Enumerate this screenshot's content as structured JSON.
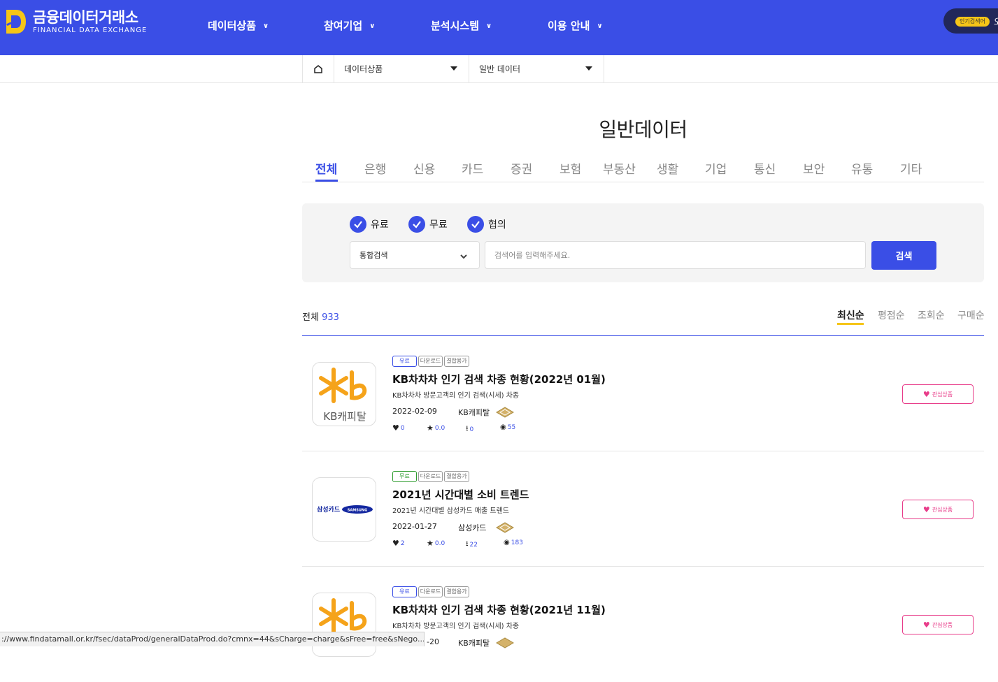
{
  "header": {
    "logo_ko": "금융데이터거래소",
    "logo_en": "FINANCIAL DATA EXCHANGE",
    "nav": [
      "데이터상품",
      "참여기업",
      "분석시스템",
      "이용 안내"
    ],
    "popular_badge": "인기검색어",
    "popular_rest": "오"
  },
  "breadcrumb": {
    "level1": "데이터상품",
    "level2": "일반 데이터"
  },
  "page_title": "일반데이터",
  "categories": [
    "전체",
    "은행",
    "신용",
    "카드",
    "증권",
    "보험",
    "부동산",
    "생활",
    "기업",
    "통신",
    "보안",
    "유통",
    "기타"
  ],
  "active_category": "전체",
  "filters": {
    "checks": [
      "유료",
      "무료",
      "협의"
    ],
    "search_type": "통합검색",
    "placeholder": "검색어를 입력해주세요.",
    "search_button": "검색"
  },
  "summary": {
    "total_label": "전체",
    "total_count": "933",
    "sorts": [
      "최신순",
      "평점순",
      "조회순",
      "구매순"
    ]
  },
  "items": [
    {
      "tags": [
        "유료",
        "다운로드",
        "결합용가"
      ],
      "title": "KB차차차 인기 검색 차종 현황(2022년 01월)",
      "desc": "KB차차차 방문고객의 인기 검색(시세) 차종",
      "date": "2022-02-09",
      "company": "KB캐피탈",
      "likes": "0",
      "rating": "0.0",
      "downloads": "0",
      "views": "55",
      "logo_text": "KB캐피탈",
      "fav": "관심상품"
    },
    {
      "tags": [
        "무료",
        "다운로드",
        "결합용가"
      ],
      "title": "2021년 시간대별 소비 트렌드",
      "desc": "2021년 시간대별 삼성카드 매출 트렌드",
      "date": "2022-01-27",
      "company": "삼성카드",
      "likes": "2",
      "rating": "0.0",
      "downloads": "22",
      "views": "183",
      "logo_text": "삼성카드",
      "logo_text2": "SAMSUNG",
      "fav": "관심상품"
    },
    {
      "tags": [
        "유료",
        "다운로드",
        "결합용가"
      ],
      "title": "KB차차차 인기 검색 차종 현황(2021년 11월)",
      "desc": "KB차차차 방문고객의 인기 검색(시세) 차종",
      "date_visible": "-20",
      "company": "KB캐피탈",
      "fav": "관심상품"
    }
  ],
  "statusbar": "://www.findatamall.or.kr/fsec/dataProd/generalDataProd.do?cmnx=44&sCharge=charge&sFree=free&sNego...",
  "colors": {
    "primary": "#3a4ee6",
    "accent_pink": "#e83d8a",
    "sort_underline": "#f5c518",
    "kb_yellow": "#f5a31a"
  }
}
